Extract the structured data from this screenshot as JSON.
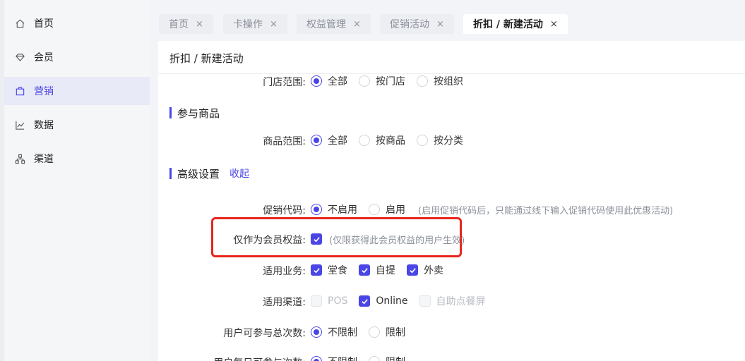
{
  "sidebar": {
    "items": [
      {
        "label": "首页",
        "icon": "home-icon"
      },
      {
        "label": "会员",
        "icon": "member-icon"
      },
      {
        "label": "营销",
        "icon": "marketing-icon",
        "active": true
      },
      {
        "label": "数据",
        "icon": "chart-icon"
      },
      {
        "label": "渠道",
        "icon": "channel-icon"
      }
    ]
  },
  "tabs": [
    {
      "label": "首页",
      "close": "×"
    },
    {
      "label": "卡操作",
      "close": "×"
    },
    {
      "label": "权益管理",
      "close": "×"
    },
    {
      "label": "促销活动",
      "close": "×"
    },
    {
      "label": "折扣 / 新建活动",
      "close": "×",
      "active": true
    }
  ],
  "page": {
    "title": "折扣 / 新建活动"
  },
  "form": {
    "store_scope": {
      "label": "门店范围:",
      "options": [
        "全部",
        "按门店",
        "按组织"
      ],
      "selected": "全部"
    },
    "goods_section": {
      "title": "参与商品"
    },
    "goods_scope": {
      "label": "商品范围:",
      "options": [
        "全部",
        "按商品",
        "按分类"
      ],
      "selected": "全部"
    },
    "advanced_section": {
      "title": "高级设置",
      "toggle": "收起"
    },
    "promo_code": {
      "label": "促销代码:",
      "options": [
        "不启用",
        "启用"
      ],
      "selected": "不启用",
      "hint": "(启用促销代码后，只能通过线下输入促销代码使用此优惠活动)"
    },
    "member_only": {
      "label": "仅作为会员权益:",
      "checked": true,
      "hint": "(仅限获得此会员权益的用户生效)"
    },
    "business": {
      "label": "适用业务:",
      "options": [
        {
          "text": "堂食",
          "checked": true
        },
        {
          "text": "自提",
          "checked": true
        },
        {
          "text": "外卖",
          "checked": true
        }
      ]
    },
    "channel": {
      "label": "适用渠道:",
      "options": [
        {
          "text": "POS",
          "checked": false,
          "disabled": true
        },
        {
          "text": "Online",
          "checked": true,
          "disabled": false
        },
        {
          "text": "自助点餐屏",
          "checked": false,
          "disabled": true
        }
      ]
    },
    "total_times": {
      "label": "用户可参与总次数:",
      "options": [
        "不限制",
        "限制"
      ],
      "selected": "不限制"
    },
    "daily_times": {
      "label": "用户每日可参与次数:",
      "options": [
        "不限制",
        "限制"
      ],
      "selected": "不限制"
    }
  },
  "colors": {
    "accent": "#4a45e5",
    "highlight_border": "#e8251c",
    "sidebar_active_bg": "#e8eaf8"
  }
}
